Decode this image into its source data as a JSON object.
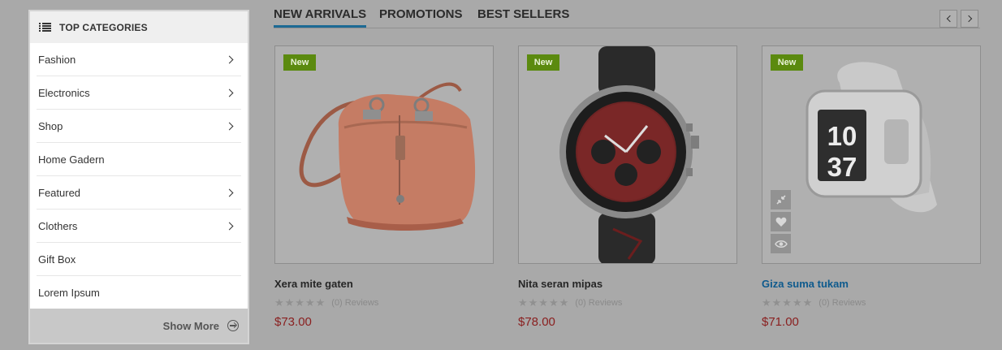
{
  "sidebar": {
    "title": "TOP CATEGORIES",
    "items": [
      {
        "label": "Fashion",
        "has_submenu": true
      },
      {
        "label": "Electronics",
        "has_submenu": true
      },
      {
        "label": "Shop",
        "has_submenu": true
      },
      {
        "label": "Home Gadern",
        "has_submenu": false
      },
      {
        "label": "Featured",
        "has_submenu": true
      },
      {
        "label": "Clothers",
        "has_submenu": true
      },
      {
        "label": "Gift Box",
        "has_submenu": false
      },
      {
        "label": "Lorem Ipsum",
        "has_submenu": false
      }
    ],
    "show_more": "Show More"
  },
  "tabs": [
    {
      "label": "NEW ARRIVALS",
      "active": true
    },
    {
      "label": "PROMOTIONS",
      "active": false
    },
    {
      "label": "BEST SELLERS",
      "active": false
    }
  ],
  "products": [
    {
      "badge": "New",
      "name": "Xera mite gaten",
      "stars": 0,
      "reviews": "(0) Reviews",
      "price": "$73.00",
      "image": "orange-handbag",
      "highlighted": false
    },
    {
      "badge": "New",
      "name": "Nita seran mipas",
      "stars": 0,
      "reviews": "(0) Reviews",
      "price": "$78.00",
      "image": "chronograph-watch",
      "highlighted": false
    },
    {
      "badge": "New",
      "name": "Giza suma tukam",
      "stars": 0,
      "reviews": "(0) Reviews",
      "price": "$71.00",
      "image": "white-sport-watch",
      "highlighted": true
    }
  ],
  "watch_display": {
    "top": "10",
    "bottom": "37"
  },
  "colors": {
    "accent": "#1d6a94",
    "badge": "#5b8a0f",
    "price": "#8a2020",
    "link": "#0e5a8d",
    "overlay": "#a9a9a9"
  }
}
